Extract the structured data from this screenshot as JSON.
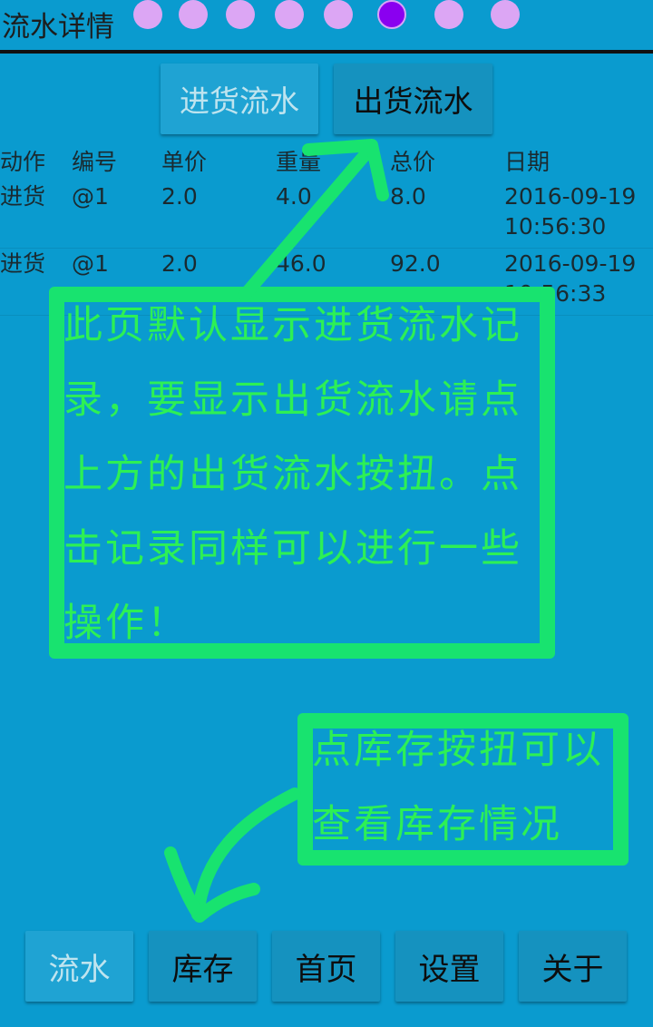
{
  "header": {
    "title": "流水详情"
  },
  "page_indicator": {
    "total": 8,
    "active_index": 5
  },
  "tabs": [
    {
      "label": "进货流水",
      "state": "inactive"
    },
    {
      "label": "出货流水",
      "state": "active"
    }
  ],
  "table": {
    "columns": [
      "动作",
      "编号",
      "单价",
      "重量",
      "总价",
      "日期"
    ],
    "rows": [
      [
        "进货",
        "@1",
        "2.0",
        "4.0",
        "8.0",
        "2016-09-19 10:56:30"
      ],
      [
        "进货",
        "@1",
        "2.0",
        "46.0",
        "92.0",
        "2016-09-19 10:56:33"
      ]
    ]
  },
  "annotations": {
    "note1": "此页默认显示进货流水记录，要显示出货流水请点上方的出货流水按扭。点击记录同样可以进行一些操作！",
    "note2": "点库存按扭可以查看库存情况",
    "color": "#18e36f"
  },
  "bottom_nav": [
    {
      "label": "流水",
      "state": "inactive"
    },
    {
      "label": "库存",
      "state": "active"
    },
    {
      "label": "首页",
      "state": "active"
    },
    {
      "label": "设置",
      "state": "active"
    },
    {
      "label": "关于",
      "state": "active"
    }
  ],
  "colors": {
    "background": "#0a9bcf",
    "button": "#1592bf",
    "dot": "#dca6f4",
    "dot_active": "#8a00f0"
  }
}
